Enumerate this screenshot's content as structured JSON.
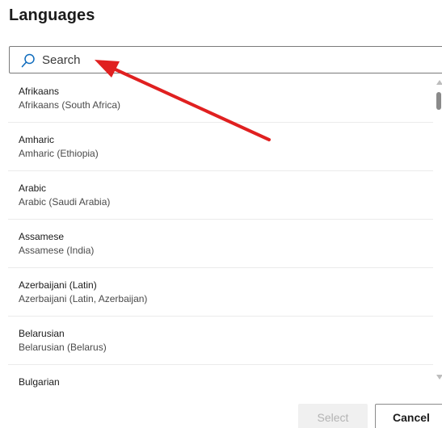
{
  "dialog": {
    "title": "Languages"
  },
  "search": {
    "placeholder": "Search",
    "value": ""
  },
  "languages": [
    {
      "name": "Afrikaans",
      "region": "Afrikaans (South Africa)"
    },
    {
      "name": "Amharic",
      "region": "Amharic (Ethiopia)"
    },
    {
      "name": "Arabic",
      "region": "Arabic (Saudi Arabia)"
    },
    {
      "name": "Assamese",
      "region": "Assamese (India)"
    },
    {
      "name": "Azerbaijani (Latin)",
      "region": "Azerbaijani (Latin, Azerbaijan)"
    },
    {
      "name": "Belarusian",
      "region": "Belarusian (Belarus)"
    },
    {
      "name": "Bulgarian",
      "region": ""
    }
  ],
  "buttons": {
    "select_label": "Select",
    "cancel_label": "Cancel"
  },
  "annotation": {
    "arrow_color": "#e02020"
  }
}
